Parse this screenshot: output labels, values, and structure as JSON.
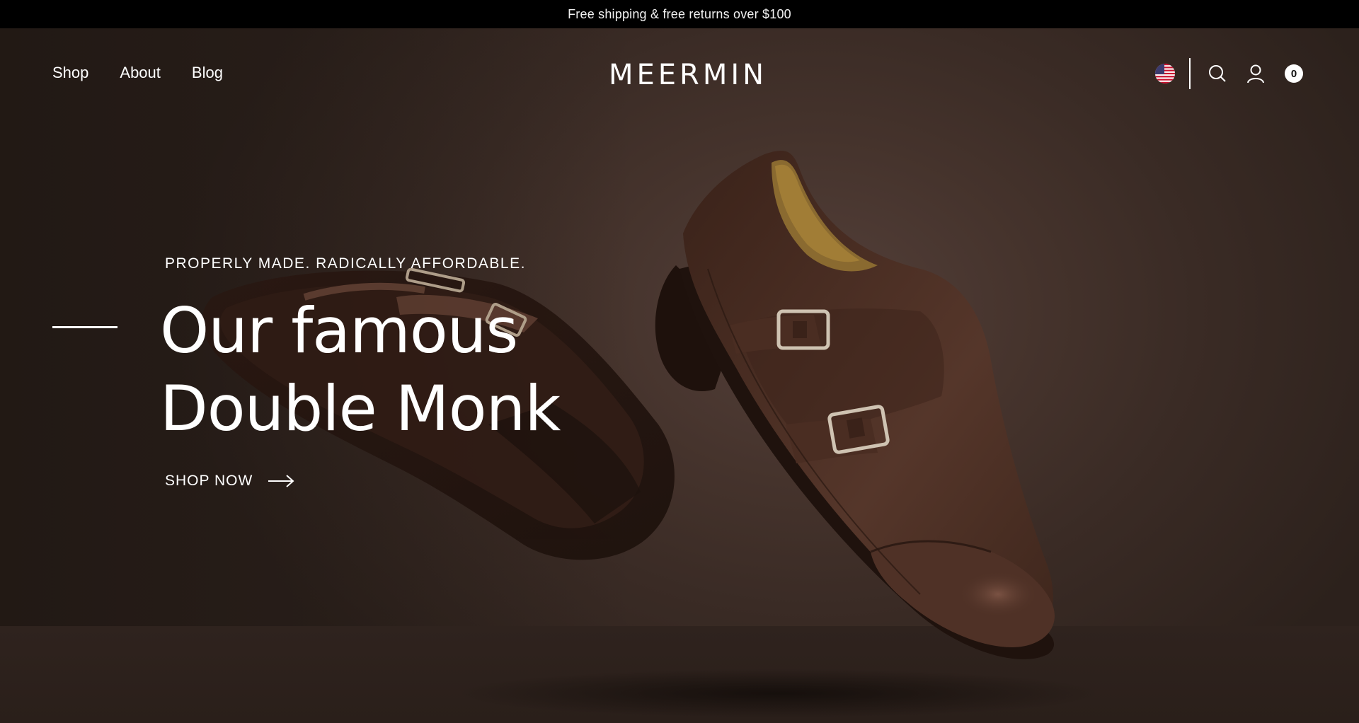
{
  "announcement": {
    "text": "Free shipping & free returns over $100"
  },
  "header": {
    "nav": [
      {
        "label": "Shop"
      },
      {
        "label": "About"
      },
      {
        "label": "Blog"
      }
    ],
    "logo": "MEERMIN",
    "icons": {
      "country": "us-flag-icon",
      "search": "search-icon",
      "account": "user-icon",
      "cart": "cart-count-badge"
    },
    "cart_count": "0"
  },
  "hero": {
    "eyebrow": "PROPERLY MADE. RADICALLY AFFORDABLE.",
    "headline_line1": "Our famous",
    "headline_line2": "Double Monk",
    "cta_label": "SHOP NOW",
    "cta_icon": "arrow-right-icon",
    "colors": {
      "background": "#45332c",
      "leather": "#4a2e24",
      "announcement_bar": "#000000"
    }
  }
}
